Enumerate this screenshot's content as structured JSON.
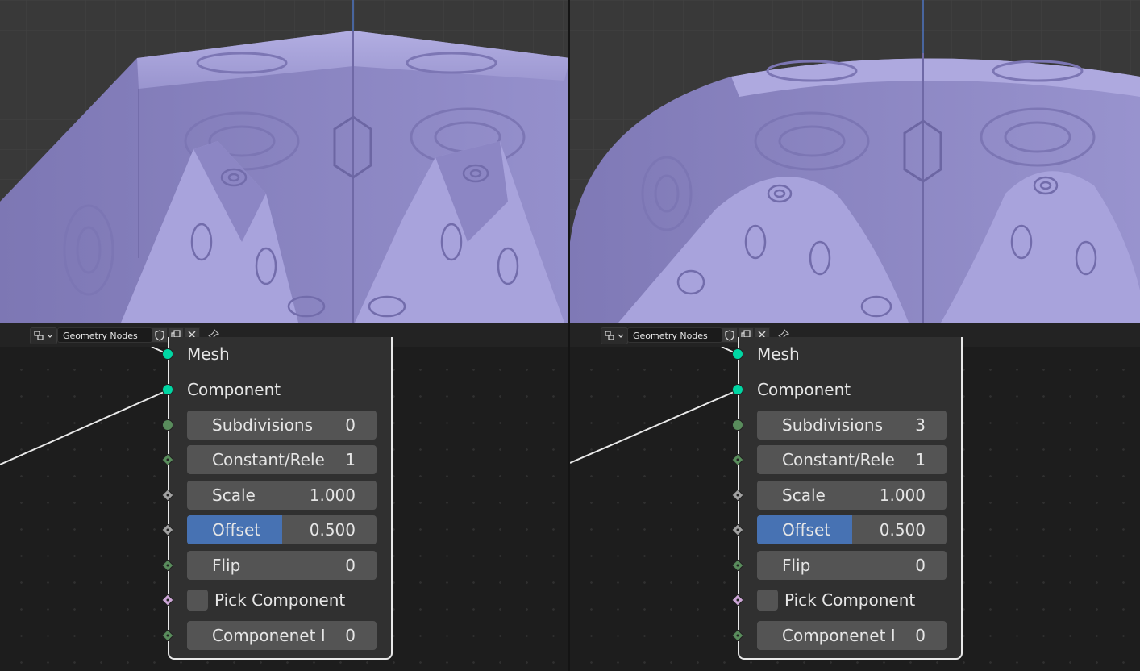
{
  "left": {
    "header": {
      "editor_name": "Geometry Nodes"
    },
    "node": {
      "outputs": [
        {
          "label": "Mesh"
        },
        {
          "label": "Component"
        }
      ],
      "inputs": {
        "subdivisions": {
          "label": "Subdivisions",
          "value": "0"
        },
        "constant": {
          "label": "Constant/Rele",
          "value": "1"
        },
        "scale": {
          "label": "Scale",
          "value": "1.000"
        },
        "offset": {
          "label": "Offset",
          "value": "0.500",
          "fill_fraction": 0.5
        },
        "flip": {
          "label": "Flip",
          "value": "0"
        },
        "pick": {
          "label": "Pick Component",
          "checked": false
        },
        "componenet": {
          "label": "Componenet I",
          "value": "0"
        }
      }
    }
  },
  "right": {
    "header": {
      "editor_name": "Geometry Nodes"
    },
    "node": {
      "outputs": [
        {
          "label": "Mesh"
        },
        {
          "label": "Component"
        }
      ],
      "inputs": {
        "subdivisions": {
          "label": "Subdivisions",
          "value": "3"
        },
        "constant": {
          "label": "Constant/Rele",
          "value": "1"
        },
        "scale": {
          "label": "Scale",
          "value": "1.000"
        },
        "offset": {
          "label": "Offset",
          "value": "0.500",
          "fill_fraction": 0.5
        },
        "flip": {
          "label": "Flip",
          "value": "0"
        },
        "pick": {
          "label": "Pick Component",
          "checked": false
        },
        "componenet": {
          "label": "Componenet I",
          "value": "0"
        }
      }
    }
  },
  "icons": {
    "editor_type": "node-editor-icon",
    "fake_user": "shield-icon",
    "duplicate": "duplicate-icon",
    "unlink": "close-icon",
    "pin": "pin-icon"
  },
  "colors": {
    "socket_geometry": "#00d6a3",
    "socket_int": "#598c5c",
    "socket_float": "#a1a1a1",
    "socket_bool": "#cca6d6",
    "field_fill": "#4772b3",
    "mesh": "#8f85c4"
  }
}
